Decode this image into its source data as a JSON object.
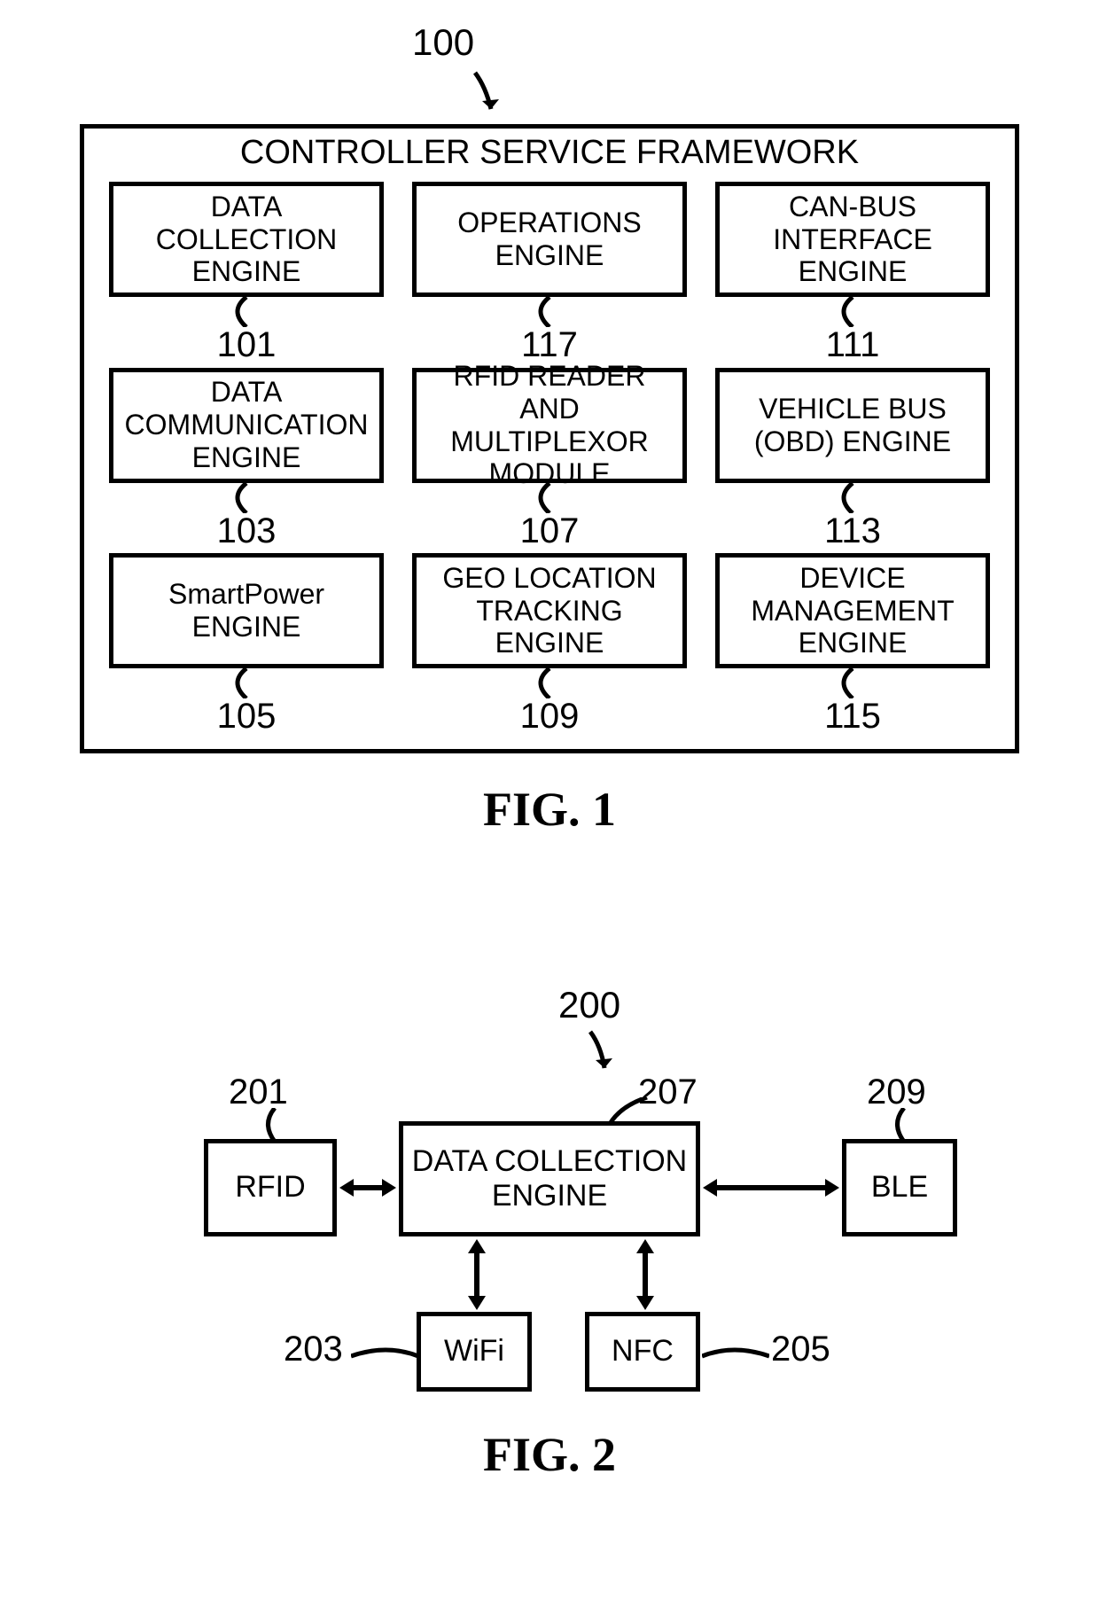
{
  "fig1": {
    "ref_main": "100",
    "framework_title": "CONTROLLER SERVICE FRAMEWORK",
    "rows": [
      [
        {
          "label": "DATA\nCOLLECTION\nENGINE",
          "ref": "101"
        },
        {
          "label": "OPERATIONS\nENGINE",
          "ref": "117"
        },
        {
          "label": "CAN-BUS\nINTERFACE\nENGINE",
          "ref": "111"
        }
      ],
      [
        {
          "label": "DATA\nCOMMUNICATION\nENGINE",
          "ref": "103"
        },
        {
          "label": "RFID READER AND\nMULTIPLEXOR\nMODULE",
          "ref": "107"
        },
        {
          "label": "VEHICLE BUS\n(OBD) ENGINE",
          "ref": "113"
        }
      ],
      [
        {
          "label": "SmartPower\nENGINE",
          "ref": "105"
        },
        {
          "label": "GEO LOCATION\nTRACKING ENGINE",
          "ref": "109"
        },
        {
          "label": "DEVICE\nMANAGEMENT\nENGINE",
          "ref": "115"
        }
      ]
    ],
    "caption": "FIG. 1"
  },
  "fig2": {
    "ref_main": "200",
    "boxes": {
      "rfid": {
        "label": "RFID",
        "ref": "201"
      },
      "wifi": {
        "label": "WiFi",
        "ref": "203"
      },
      "nfc": {
        "label": "NFC",
        "ref": "205"
      },
      "dce": {
        "label": "DATA COLLECTION\nENGINE",
        "ref": "207"
      },
      "ble": {
        "label": "BLE",
        "ref": "209"
      }
    },
    "caption": "FIG. 2"
  }
}
